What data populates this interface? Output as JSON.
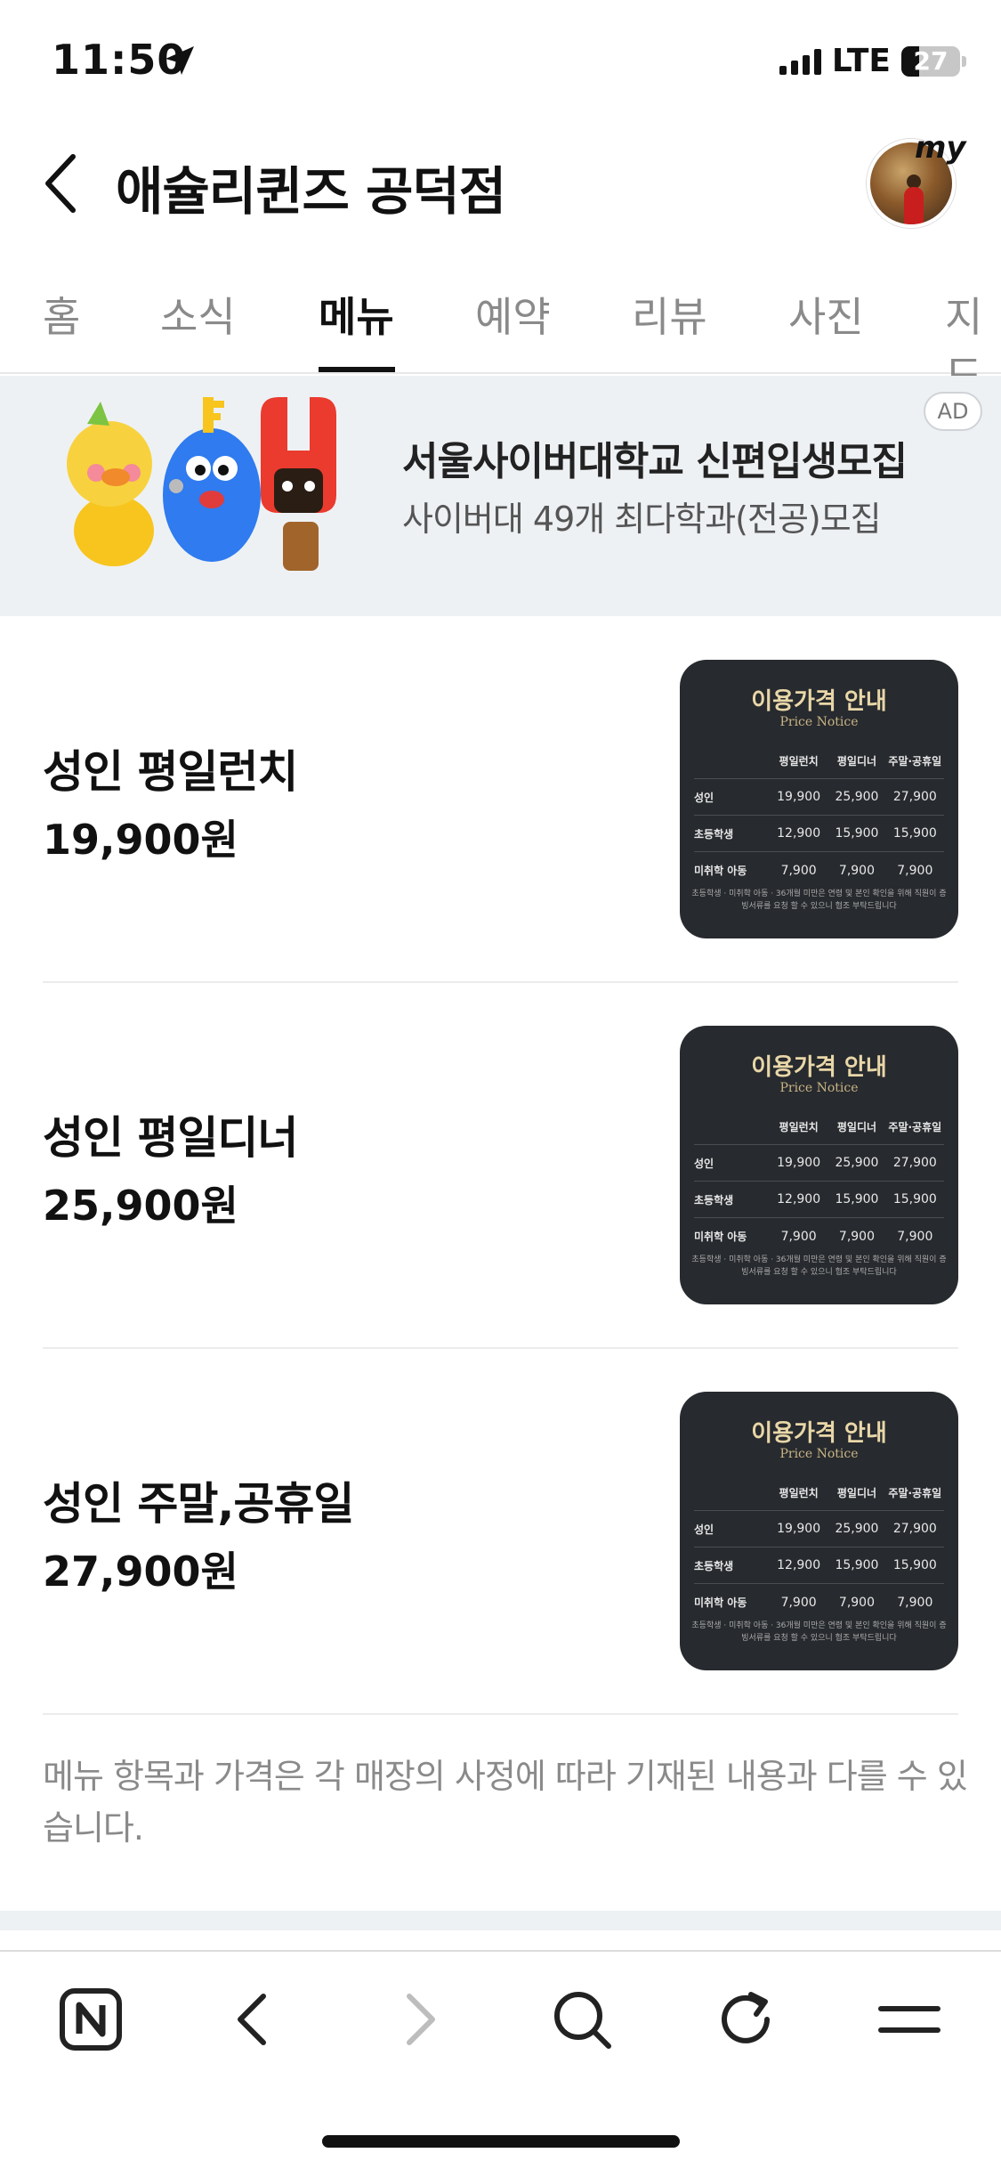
{
  "status_bar": {
    "time": "11:50",
    "network": "LTE",
    "battery": "27"
  },
  "header": {
    "title": "애슐리퀸즈 공덕점",
    "profile_badge": "my"
  },
  "tabs": [
    {
      "label": "홈"
    },
    {
      "label": "소식"
    },
    {
      "label": "메뉴"
    },
    {
      "label": "예약"
    },
    {
      "label": "리뷰"
    },
    {
      "label": "사진"
    },
    {
      "label": "지도"
    }
  ],
  "active_tab": "메뉴",
  "ad": {
    "title": "서울사이버대학교 신편입생모집",
    "subtitle": "사이버대 49개 최다학과(전공)모집",
    "badge": "AD"
  },
  "price_notice_image": {
    "title": "이용가격 안내",
    "subtitle": "Price Notice",
    "headers": [
      "",
      "평일런치",
      "평일디너",
      "주말·공휴일"
    ],
    "rows": [
      [
        "성인",
        "19,900",
        "25,900",
        "27,900"
      ],
      [
        "초등학생",
        "12,900",
        "15,900",
        "15,900"
      ],
      [
        "미취학 아동",
        "7,900",
        "7,900",
        "7,900"
      ]
    ],
    "footnote": "초등학생 · 미취학 아동 · 36개월 미만은 연령 및 본인 확인을 위해 직원이 증빙서류를 요청 할 수 있으니 협조 부탁드립니다"
  },
  "menu_items": [
    {
      "name": "성인 평일런치",
      "price": "19,900원"
    },
    {
      "name": "성인 평일디너",
      "price": "25,900원"
    },
    {
      "name": "성인 주말,공휴일",
      "price": "27,900원"
    }
  ],
  "notice": "메뉴 항목과 가격은 각 매장의 사정에 따라 기재된 내용과 다를 수 있습니다.",
  "colors": {
    "ad_bg": "#eef1f4",
    "thumb_bg": "#272a2e",
    "thumb_gold": "#e9d7a8",
    "muted_text": "#8a8a8a"
  },
  "toolbar_icons": [
    "naver-n-icon",
    "back-arrow-icon",
    "forward-arrow-icon",
    "search-icon",
    "refresh-icon",
    "menu-icon"
  ]
}
